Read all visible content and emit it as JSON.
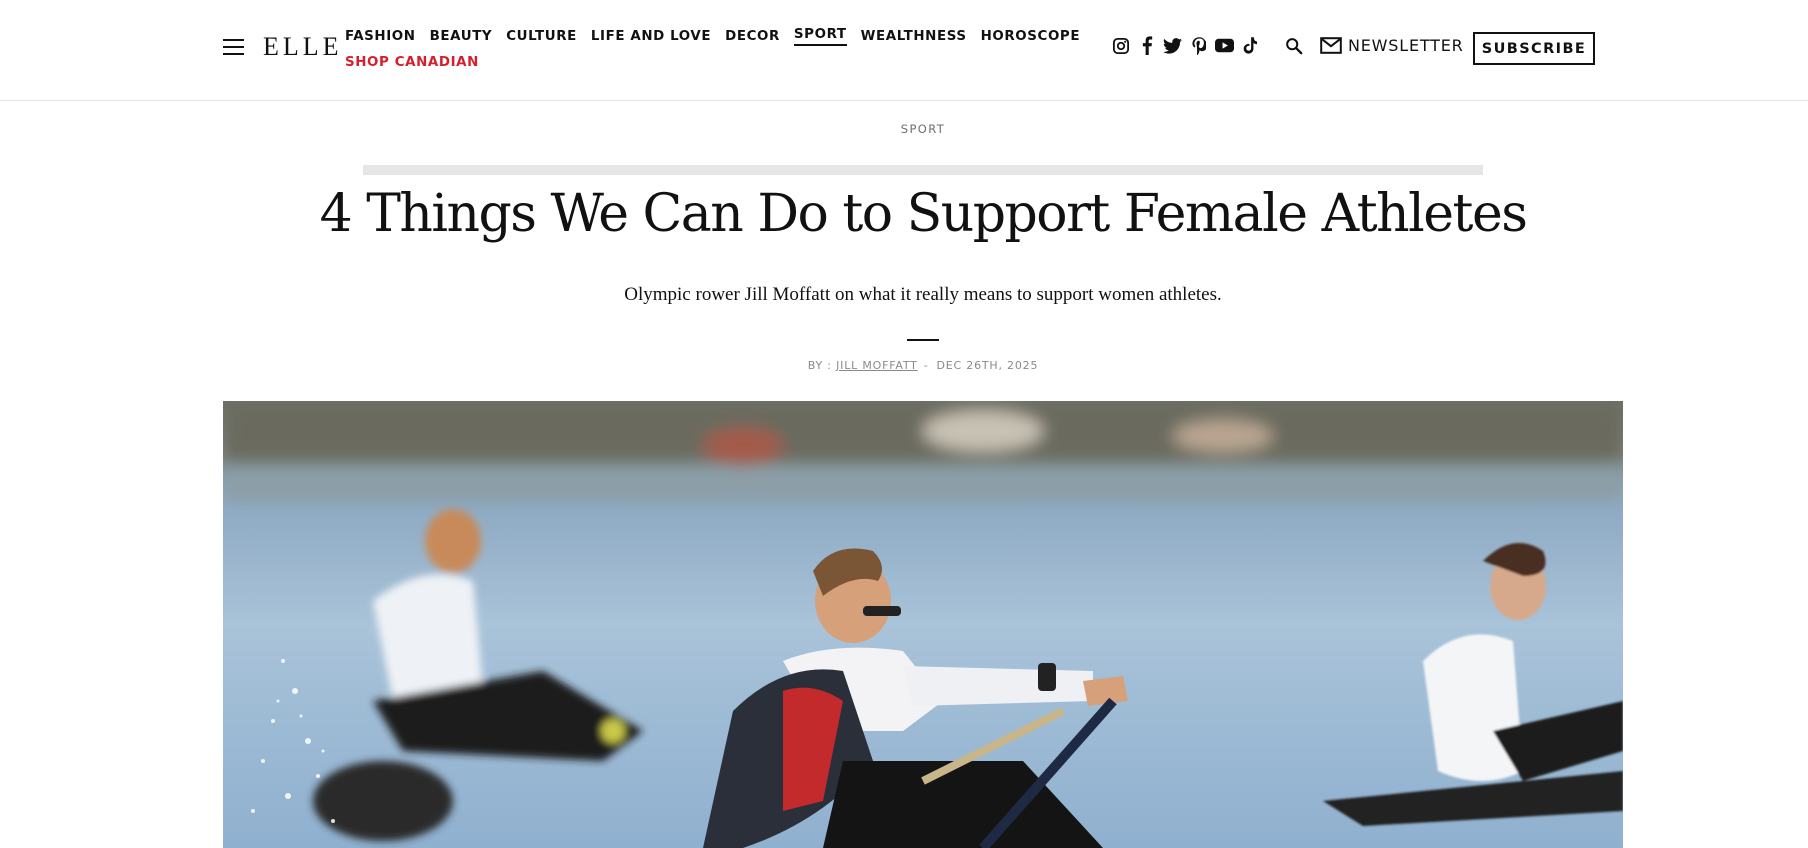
{
  "header": {
    "logo": "ELLE",
    "nav_row1": [
      "FASHION",
      "BEAUTY",
      "CULTURE",
      "LIFE AND LOVE",
      "DECOR",
      "SPORT",
      "WEALTHNESS",
      "HOROSCOPE"
    ],
    "nav_row2": [
      "SHOP CANADIAN"
    ],
    "active_nav": "SPORT",
    "newsletter_label": "NEWSLETTER",
    "subscribe_label": "SUBSCRIBE",
    "socials": [
      "instagram-icon",
      "facebook-icon",
      "twitter-icon",
      "pinterest-icon",
      "youtube-icon",
      "tiktok-icon"
    ]
  },
  "article": {
    "section": "SPORT",
    "title": "4 Things We Can Do to Support Female Athletes",
    "dek": "Olympic rower Jill Moffatt on what it really means to support women athletes.",
    "byline_prefix": "BY :",
    "author": "JILL MOFFATT",
    "separator": "-",
    "date": "DEC 26TH, 2025"
  },
  "colors": {
    "accent_red": "#d3202c",
    "text": "#111111",
    "muted": "#8a8a8a"
  }
}
